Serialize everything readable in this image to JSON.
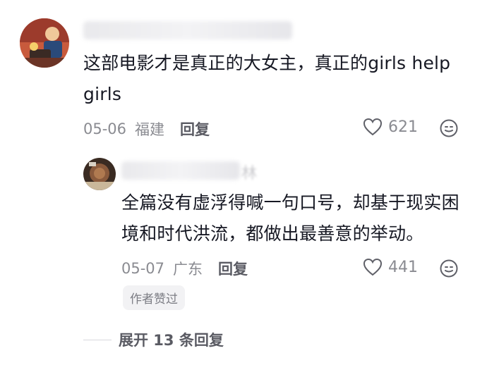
{
  "comments": [
    {
      "text": "这部电影才是真正的大女主，真正的girls help girls",
      "date": "05-06",
      "location": "福建",
      "reply_label": "回复",
      "like_count": "621",
      "avatar_icon": "cartoon-avatar-icon"
    }
  ],
  "reply": {
    "username_tail": "林",
    "text": "全篇没有虚浮得喊一句口号，却基于现实困境和时代洪流，都做出最善意的举动。",
    "date": "05-07",
    "location": "广东",
    "reply_label": "回复",
    "like_count": "441",
    "badge": "作者赞过",
    "avatar_icon": "food-photo-avatar-icon"
  },
  "expand_label": "展开 13 条回复",
  "colors": {
    "text_primary": "#161823",
    "text_secondary": "#8a8b91",
    "badge_bg": "#f2f2f4"
  }
}
